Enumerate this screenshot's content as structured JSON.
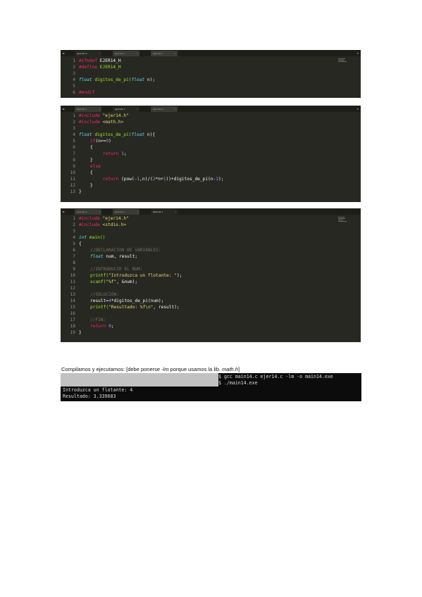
{
  "editor1": {
    "tabs": [
      "ejer14.h",
      "ejer14.c",
      "main14.c"
    ],
    "lines": [
      "1",
      "2",
      "3",
      "4",
      "5",
      "6"
    ],
    "code": {
      "l1a": "#ifndef",
      "l1b": " EJER14_H",
      "l2a": "#define",
      "l2b": " EJER14_H",
      "l4a": "float",
      "l4b": " digitos_de_pi(",
      "l4c": "float",
      "l4d": " n);",
      "l6a": "#endif"
    }
  },
  "editor2": {
    "tabs": [
      "main14.c",
      "ejer14.c",
      "ejer14.h"
    ],
    "lines": [
      "1",
      "2",
      "3",
      "4",
      "5",
      "6",
      "7",
      "8",
      "9",
      "10",
      "11",
      "12",
      "13"
    ],
    "code": {
      "l1a": "#include",
      "l1b": " \"ejer14.h\"",
      "l2a": "#include",
      "l2b": " <math.h>",
      "l4a": "float",
      "l4b": " digitos_de_pi(",
      "l4c": "float",
      "l4d": " n){",
      "l5a": "if",
      "l5b": "(n==",
      "l5c": "0",
      "l5d": ")",
      "l6a": "{",
      "l7a": "return",
      "l7b": " ",
      "l7c": "1",
      "l7d": ";",
      "l8a": "}",
      "l9a": "else",
      "l10a": "{",
      "l11a": "return",
      "l11b": " (pow(-",
      "l11c": "1",
      "l11d": ",n)/(",
      "l11e": "2",
      "l11f": "*n+",
      "l11g": "1",
      "l11h": "))+digitos_de_pi(n-",
      "l11i": "1",
      "l11j": ");",
      "l12a": "}",
      "l13a": "}"
    }
  },
  "editor3": {
    "tabs": [
      "ejer14.h",
      "ejer14.c",
      "main14.c"
    ],
    "lines": [
      "1",
      "2",
      "3",
      "4",
      "5",
      "6",
      "7",
      "8",
      "9",
      "10",
      "11",
      "12",
      "13",
      "14",
      "15",
      "16",
      "17",
      "18",
      "19"
    ],
    "code": {
      "l1a": "#include",
      "l1b": " \"ejer14.h\"",
      "l2a": "#include",
      "l2b": " <stdio.h>",
      "l4a": "int",
      "l4b": " main()",
      "l5a": "{",
      "l6a": "//DECLARACION DE VARIABLES:",
      "l7a": "float",
      "l7b": " num, result;",
      "l9a": "//INTRODUCIR EL NUM:",
      "l10a": "printf(",
      "l10b": "\"Introduzca un flotante: \"",
      "l10c": ");",
      "l11a": "scanf(",
      "l11b": "\"%f\"",
      "l11c": ", &num);",
      "l13a": "//SOLUCION:",
      "l14a": "result=",
      "l14b": "4",
      "l14c": "*digitos_de_pi(num);",
      "l15a": "printf(",
      "l15b": "\"Resultado: %f\\n\"",
      "l15c": ", result);",
      "l17a": "//FIN:",
      "l18a": "return",
      "l18b": " ",
      "l18c": "0",
      "l18d": ";",
      "l19a": "}"
    }
  },
  "caption": {
    "pre": "Compilamos y ejecutamos: [debe ponerse ",
    "flag": "-lm",
    "mid": " porque usamos la lib. ",
    "lib": "math.h",
    "post": "]"
  },
  "terminal": {
    "cmd1": "$ gcc main14.c ejer14.c -lm -o main14.exe",
    "cmd2": "$ ./main14.exe",
    "out1": "Introduzca un flotante: 4",
    "out2": "Resultado: 3.339683"
  }
}
